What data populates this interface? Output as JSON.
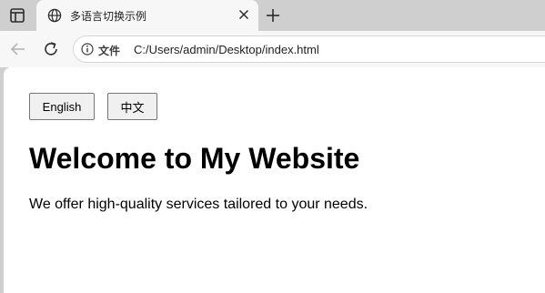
{
  "browser": {
    "tab": {
      "title": "多语言切换示例"
    },
    "address_bar": {
      "scheme_label": "文件",
      "url": "C:/Users/admin/Desktop/index.html"
    }
  },
  "page": {
    "buttons": {
      "english": "English",
      "chinese": "中文"
    },
    "heading": "Welcome to My Website",
    "description": "We offer high-quality services tailored to your needs."
  },
  "icons": {
    "sidebar": "sidebar-icon",
    "globe": "globe-icon",
    "close": "close-icon",
    "new_tab": "plus-icon",
    "back": "back-arrow-icon",
    "reload": "reload-icon",
    "info": "info-icon"
  }
}
